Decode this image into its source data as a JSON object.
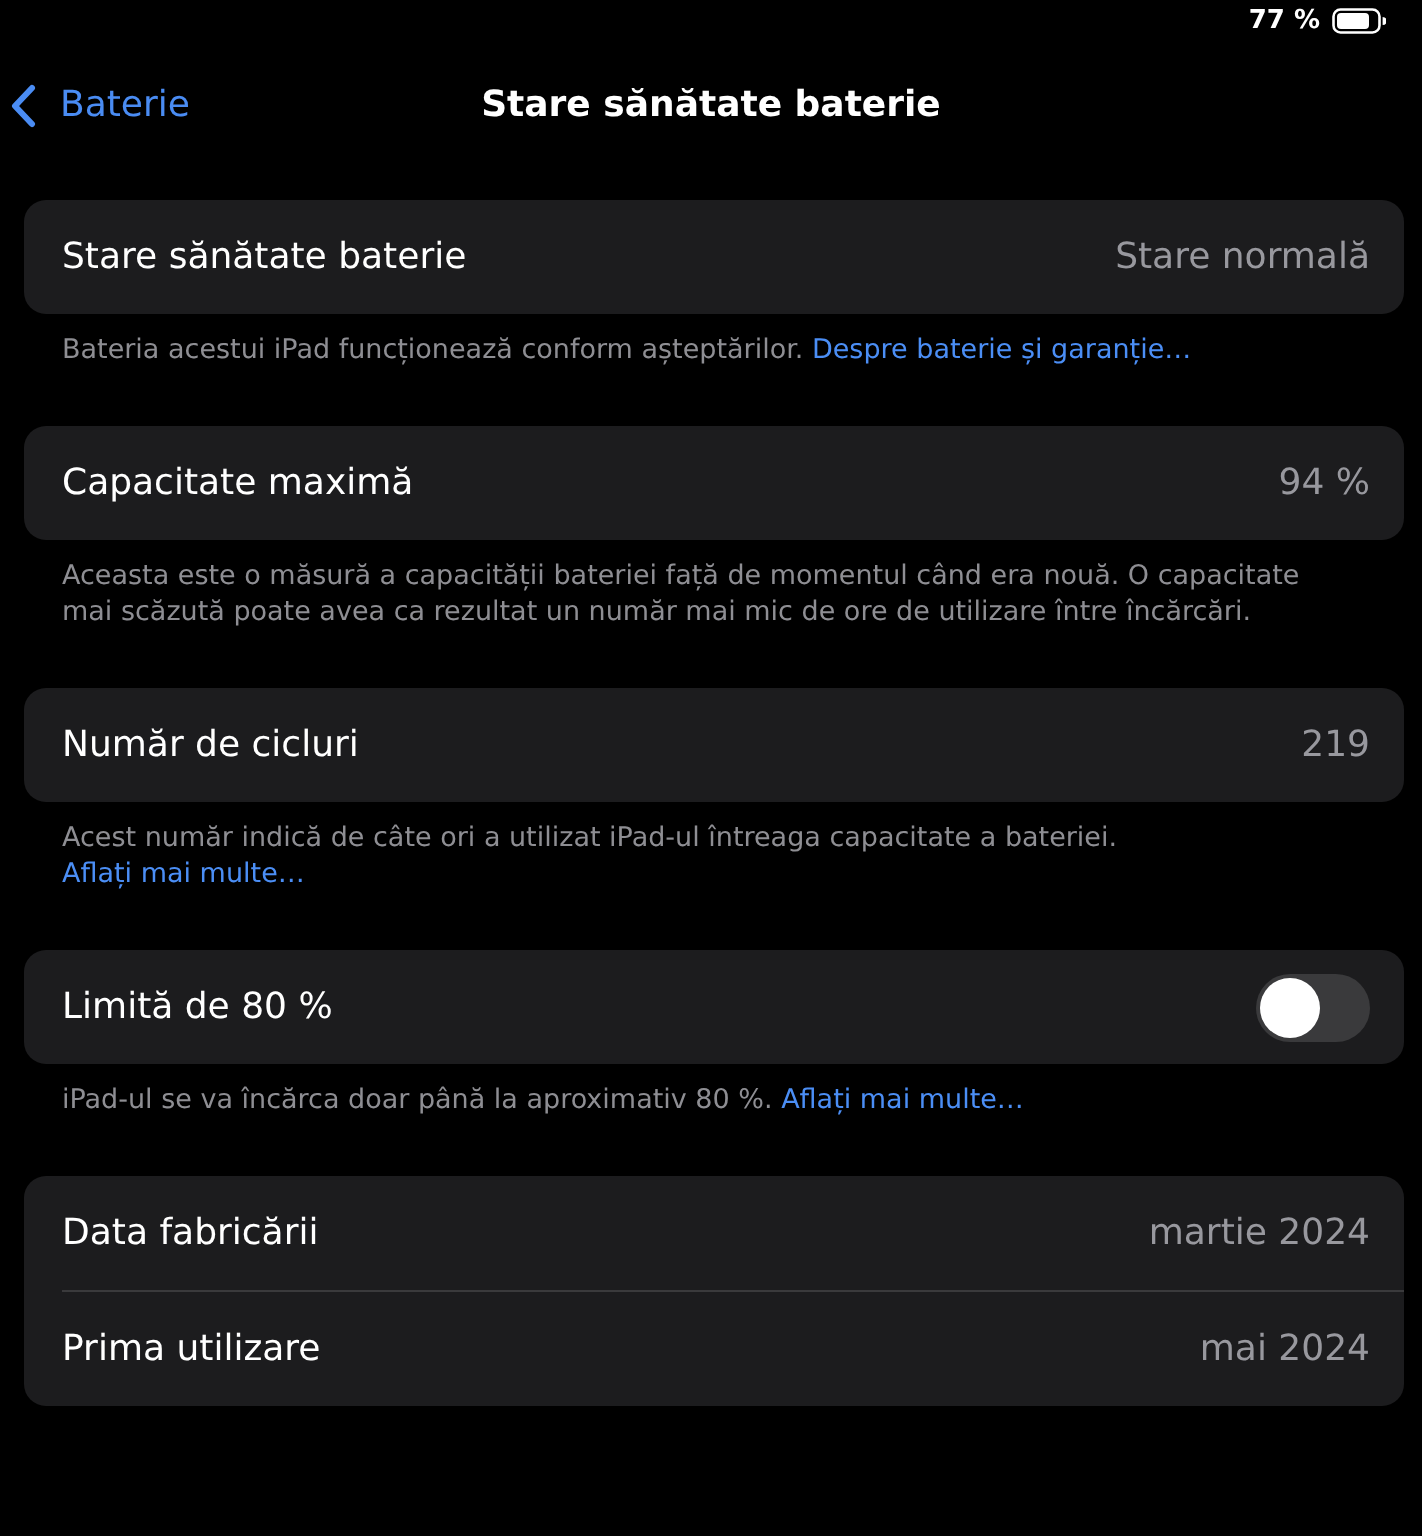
{
  "status_bar": {
    "battery_text": "77 %"
  },
  "nav_bar": {
    "back_label": "Baterie",
    "title": "Stare sănătate baterie"
  },
  "sections": [
    {
      "rows": [
        {
          "kind": "value",
          "label": "Stare sănătate baterie",
          "value": "Stare normală"
        }
      ],
      "footer": {
        "text": "Bateria acestui iPad funcționează conform așteptărilor.",
        "link": "Despre baterie și garanție…"
      }
    },
    {
      "rows": [
        {
          "kind": "value",
          "label": "Capacitate maximă",
          "value": "94 %"
        }
      ],
      "footer": {
        "text": "Aceasta este o măsură a capacității bateriei față de momentul când era nouă. O capacitate mai scăzută poate avea ca rezultat un număr mai mic de ore de utilizare între încărcări."
      }
    },
    {
      "rows": [
        {
          "kind": "value",
          "label": "Număr de cicluri",
          "value": "219"
        }
      ],
      "footer": {
        "text": "Acest număr indică de câte ori a utilizat iPad-ul întreaga capacitate a bateriei.",
        "link": "Aflați mai multe…"
      }
    },
    {
      "rows": [
        {
          "kind": "toggle",
          "label": "Limită de 80 %",
          "on": false
        }
      ],
      "footer": {
        "text": "iPad-ul se va încărca doar până la aproximativ 80 %.",
        "link": "Aflați mai multe…"
      }
    },
    {
      "rows": [
        {
          "kind": "value",
          "label": "Data fabricării",
          "value": "martie 2024"
        },
        {
          "kind": "value",
          "label": "Prima utilizare",
          "value": "mai 2024"
        }
      ]
    }
  ]
}
